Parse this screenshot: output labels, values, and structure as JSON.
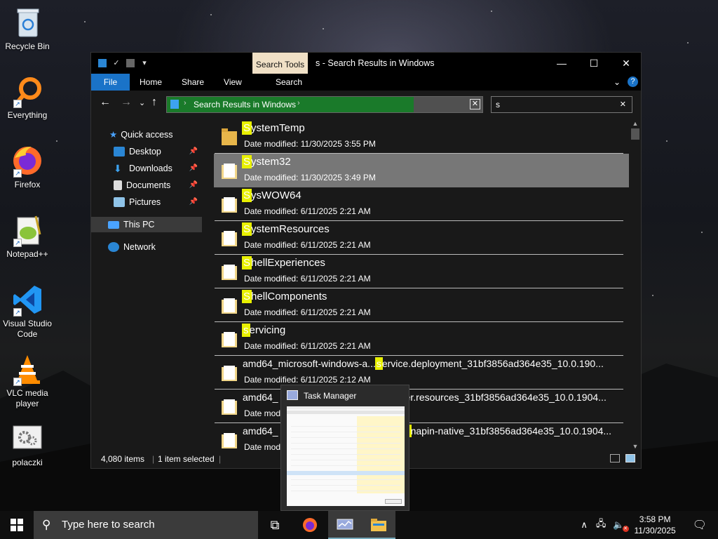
{
  "desktop": {
    "icons": [
      {
        "label": "Recycle Bin"
      },
      {
        "label": "Everything"
      },
      {
        "label": "Firefox"
      },
      {
        "label": "Notepad++"
      },
      {
        "label": "Visual Studio Code"
      },
      {
        "label": "VLC media player"
      },
      {
        "label": "polaczki"
      }
    ]
  },
  "explorer": {
    "title": "s - Search Results in Windows",
    "context_tab": "Search Tools",
    "ribbon_tabs": [
      "File",
      "Home",
      "Share",
      "View",
      "Search"
    ],
    "address": "Search Results in Windows",
    "search_value": "s",
    "nav": {
      "quick_access": "Quick access",
      "desktop": "Desktop",
      "downloads": "Downloads",
      "documents": "Documents",
      "pictures": "Pictures",
      "this_pc": "This PC",
      "network": "Network"
    },
    "rows": [
      {
        "hl": "S",
        "rest": "ystemTemp",
        "date": "Date modified: 11/30/2025 3:55 PM"
      },
      {
        "hl": "S",
        "rest": "ystem32",
        "date": "Date modified: 11/30/2025 3:49 PM"
      },
      {
        "hl": "S",
        "rest": "ysWOW64",
        "date": "Date modified: 6/11/2025 2:21 AM"
      },
      {
        "hl": "S",
        "rest": "ystemResources",
        "date": "Date modified: 6/11/2025 2:21 AM"
      },
      {
        "hl": "S",
        "rest": "hellExperiences",
        "date": "Date modified: 6/11/2025 2:21 AM"
      },
      {
        "hl": "S",
        "rest": "hellComponents",
        "date": "Date modified: 6/11/2025 2:21 AM"
      },
      {
        "hl": "s",
        "rest": "ervicing",
        "date": "Date modified: 6/11/2025 2:21 AM"
      },
      {
        "pre": "amd64_microsoft-windows-a...",
        "hl": "s",
        "rest": "ervice.deployment_31bf3856ad364e35_10.0.190...",
        "date": "Date modified: 6/11/2025 2:12 AM"
      },
      {
        "pre": "amd64_",
        "hl": "",
        "rest": "ver.resources_31bf3856ad364e35_10.0.1904...",
        "date": "Date modi"
      },
      {
        "pre": "amd64_",
        "hl": "s",
        "rest": "napin-native_31bf3856ad364e35_10.0.1904...",
        "date": "Date mod"
      }
    ],
    "status": {
      "count": "4,080 items",
      "selected": "1 item selected"
    }
  },
  "taskbar": {
    "search_placeholder": "Type here to search",
    "time": "3:58 PM",
    "date": "11/30/2025",
    "thumbnail_title": "Task Manager"
  }
}
